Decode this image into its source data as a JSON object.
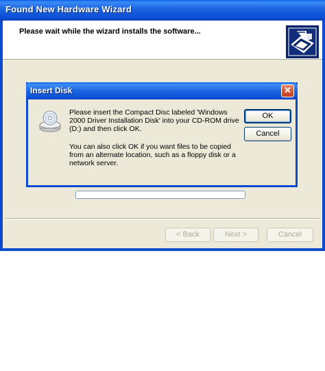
{
  "wizard": {
    "title": "Found New Hardware Wizard",
    "header_text": "Please wait while the wizard installs the software...",
    "progress": 0,
    "buttons": {
      "back": "< Back",
      "next": "Next >",
      "cancel": "Cancel"
    }
  },
  "dialog": {
    "title": "Insert Disk",
    "close_glyph": "✕",
    "message1": "Please insert the Compact Disc labeled 'Windows 2000 Driver Installation Disk' into your CD-ROM drive (D:) and then click OK.",
    "message2": "You can also click OK if you want files to be copied from an alternate location, such as a floppy disk or a network server.",
    "ok_label": "OK",
    "cancel_label": "Cancel",
    "icon": "cd-drive-icon"
  },
  "icons": {
    "header": "hardware-install-icon",
    "close": "close-icon"
  }
}
